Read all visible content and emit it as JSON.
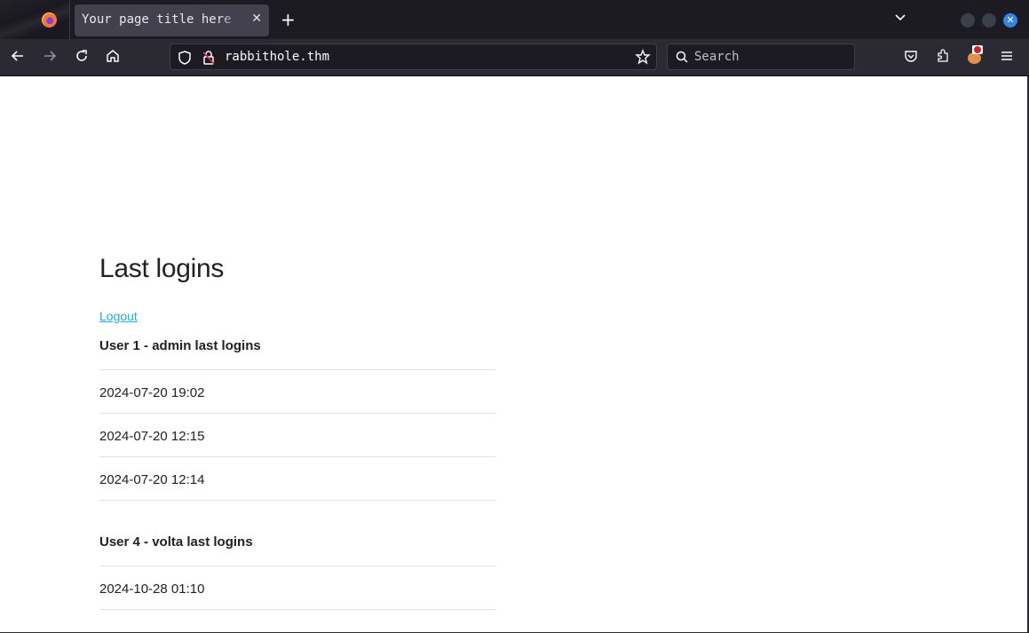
{
  "browser": {
    "tab": {
      "title": "Your page title here",
      "close_icon": "close-icon"
    },
    "new_tab_icon": "plus-icon",
    "tab_list_icon": "chevron-down-icon",
    "window_controls": [
      "minimize",
      "maximize",
      "close"
    ],
    "toolbar": {
      "back_icon": "arrow-left-icon",
      "forward_icon": "arrow-right-icon",
      "reload_icon": "reload-icon",
      "home_icon": "home-icon",
      "url": "rabbithole.thm",
      "search_placeholder": "Search",
      "right_icons": [
        "pocket-icon",
        "extensions-icon",
        "ublock-icon",
        "menu-icon"
      ]
    },
    "accent_close_color": "#3584e4"
  },
  "page": {
    "title": "Last logins",
    "logout_label": "Logout",
    "link_color": "#1eaedb",
    "users": [
      {
        "heading": "User 1 - admin last logins",
        "logins": [
          "2024-07-20 19:02",
          "2024-07-20 12:15",
          "2024-07-20 12:14"
        ]
      },
      {
        "heading": "User 4 - volta last logins",
        "logins": [
          "2024-10-28 01:10"
        ]
      }
    ]
  }
}
